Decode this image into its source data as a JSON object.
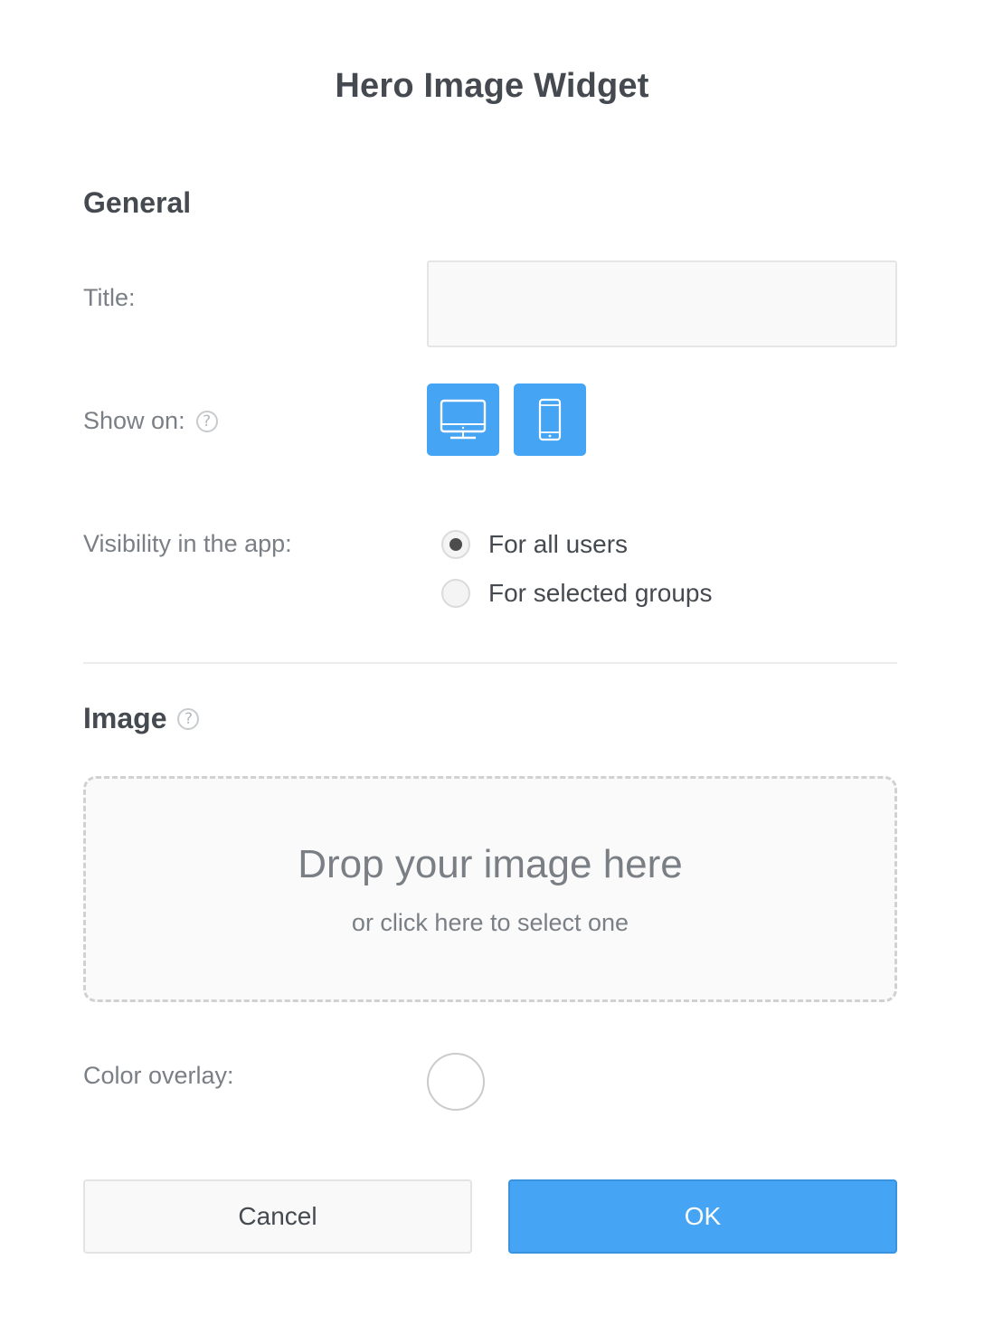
{
  "dialog": {
    "title": "Hero Image Widget"
  },
  "general": {
    "heading": "General",
    "title_label": "Title:",
    "title_value": "",
    "title_placeholder": "",
    "show_on_label": "Show on:",
    "show_on_options": [
      {
        "icon": "desktop-icon",
        "selected": true
      },
      {
        "icon": "mobile-phone-icon",
        "selected": true
      }
    ],
    "visibility_label": "Visibility in the app:",
    "visibility_options": [
      {
        "label": "For all users",
        "selected": true
      },
      {
        "label": "For selected groups",
        "selected": false
      }
    ]
  },
  "image": {
    "heading": "Image",
    "drop_main": "Drop your image here",
    "drop_sub": "or click here to select one",
    "color_overlay_label": "Color overlay:",
    "color_overlay_value": "#ffffff"
  },
  "buttons": {
    "cancel": "Cancel",
    "ok": "OK"
  },
  "help_glyph": "?",
  "colors": {
    "accent": "#45a4f3",
    "text_dark": "#454a50",
    "text_muted": "#7a7f85"
  }
}
